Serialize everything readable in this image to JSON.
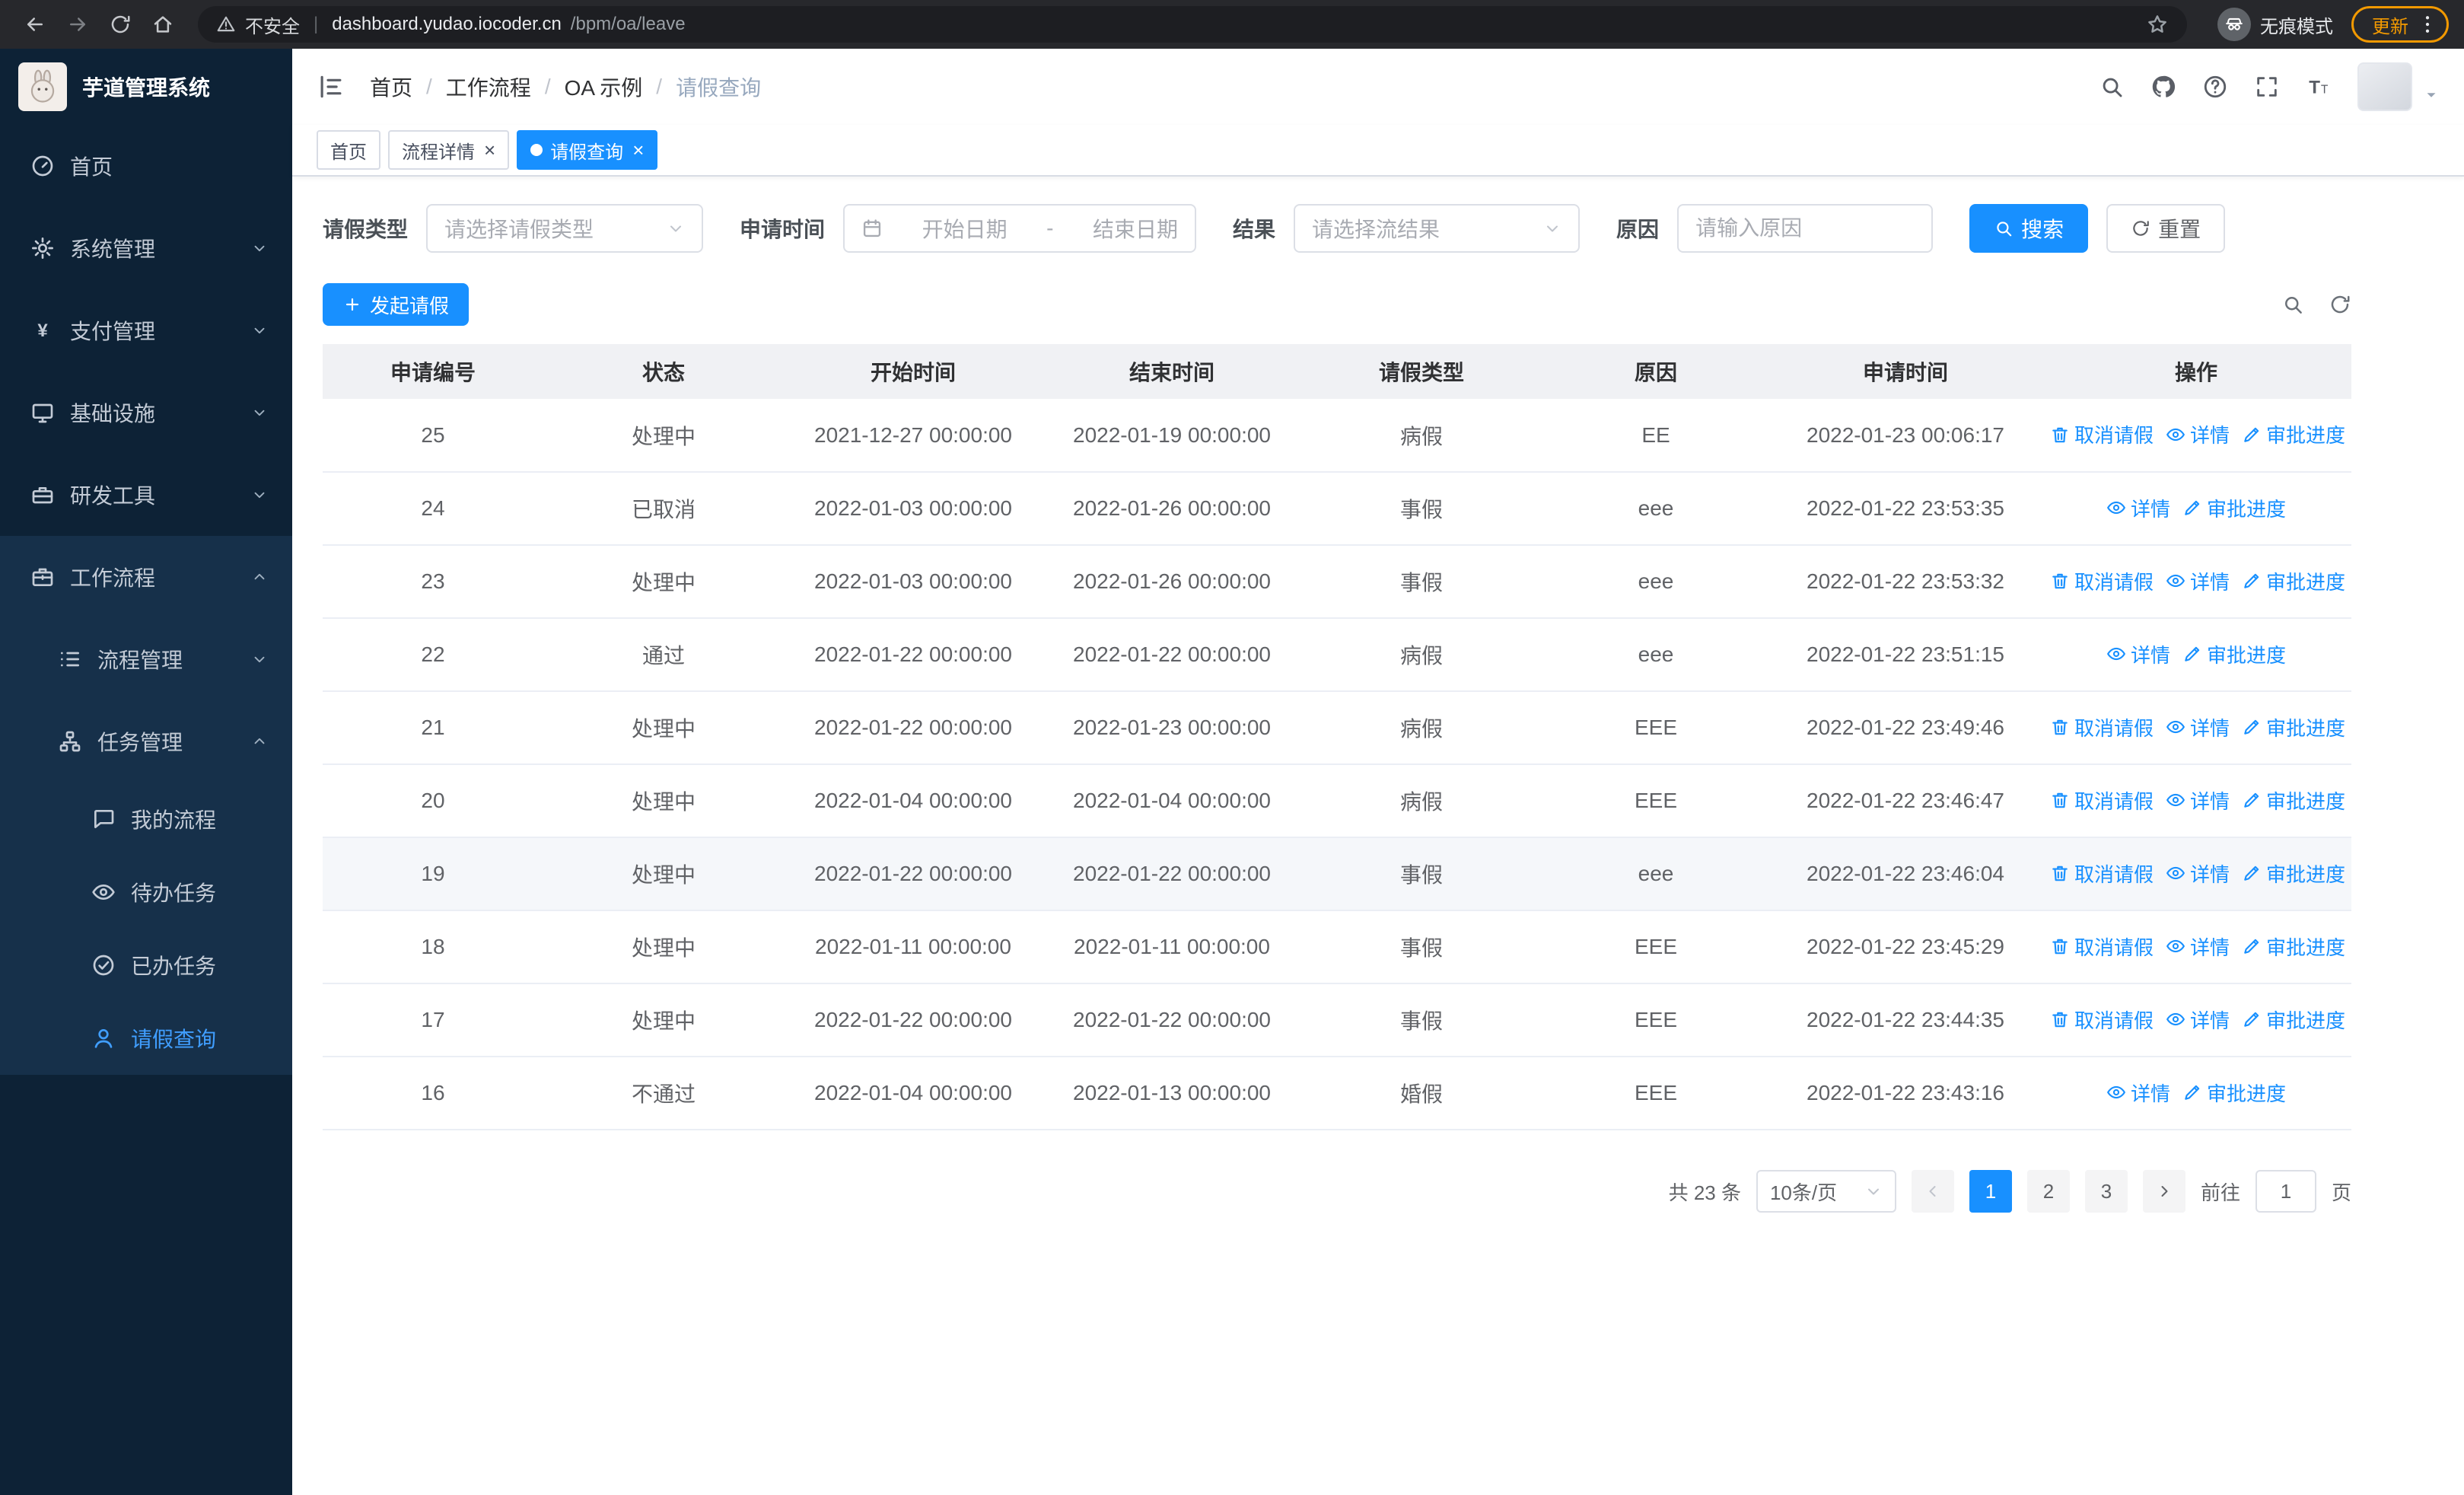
{
  "browser": {
    "security_label": "不安全",
    "separator": "|",
    "url_host": "dashboard.yudao.iocoder.cn",
    "url_path": "/bpm/oa/leave",
    "incognito_label": "无痕模式",
    "update_label": "更新"
  },
  "sidebar": {
    "logo_title": "芋道管理系统",
    "items": [
      {
        "key": "home",
        "label": "首页",
        "icon": "dashboard",
        "level": 1
      },
      {
        "key": "system",
        "label": "系统管理",
        "icon": "gear",
        "level": 1,
        "arrow": "down"
      },
      {
        "key": "payment",
        "label": "支付管理",
        "icon": "yen",
        "level": 1,
        "arrow": "down"
      },
      {
        "key": "infra",
        "label": "基础设施",
        "icon": "monitor",
        "level": 1,
        "arrow": "down"
      },
      {
        "key": "devtools",
        "label": "研发工具",
        "icon": "toolbox",
        "level": 1,
        "arrow": "down"
      },
      {
        "key": "workflow",
        "label": "工作流程",
        "icon": "briefcase",
        "level": 1,
        "arrow": "up",
        "section": true
      },
      {
        "key": "process-mgmt",
        "label": "流程管理",
        "icon": "list",
        "level": 2,
        "arrow": "down",
        "section": true
      },
      {
        "key": "task-mgmt",
        "label": "任务管理",
        "icon": "sitemap",
        "level": 2,
        "arrow": "up",
        "section": true
      },
      {
        "key": "my-process",
        "label": "我的流程",
        "icon": "chat",
        "level": 3,
        "section": true
      },
      {
        "key": "todo-task",
        "label": "待办任务",
        "icon": "eye",
        "level": 3,
        "section": true
      },
      {
        "key": "done-task",
        "label": "已办任务",
        "icon": "check-circle",
        "level": 3,
        "section": true
      },
      {
        "key": "leave-query",
        "label": "请假查询",
        "icon": "user",
        "level": 3,
        "active": true,
        "section": true
      }
    ]
  },
  "header": {
    "breadcrumb": [
      "首页",
      "工作流程",
      "OA 示例",
      "请假查询"
    ]
  },
  "tabs": [
    {
      "label": "首页",
      "active": false,
      "closable": false
    },
    {
      "label": "流程详情",
      "active": false,
      "closable": true
    },
    {
      "label": "请假查询",
      "active": true,
      "closable": true
    }
  ],
  "filters": {
    "type_label": "请假类型",
    "type_placeholder": "请选择请假类型",
    "time_label": "申请时间",
    "start_placeholder": "开始日期",
    "range_separator": "-",
    "end_placeholder": "结束日期",
    "result_label": "结果",
    "result_placeholder": "请选择流结果",
    "reason_label": "原因",
    "reason_placeholder": "请输入原因",
    "search_label": "搜索",
    "reset_label": "重置"
  },
  "toolbar": {
    "create_label": "发起请假"
  },
  "table": {
    "headers": [
      "申请编号",
      "状态",
      "开始时间",
      "结束时间",
      "请假类型",
      "原因",
      "申请时间",
      "操作"
    ],
    "action_labels": {
      "cancel": "取消请假",
      "detail": "详情",
      "progress": "审批进度"
    },
    "rows": [
      {
        "id": "25",
        "status": "处理中",
        "start": "2021-12-27 00:00:00",
        "end": "2022-01-19 00:00:00",
        "type": "病假",
        "reason": "EE",
        "applied": "2022-01-23 00:06:17",
        "actions": [
          "cancel",
          "detail",
          "progress"
        ]
      },
      {
        "id": "24",
        "status": "已取消",
        "start": "2022-01-03 00:00:00",
        "end": "2022-01-26 00:00:00",
        "type": "事假",
        "reason": "eee",
        "applied": "2022-01-22 23:53:35",
        "actions": [
          "detail",
          "progress"
        ]
      },
      {
        "id": "23",
        "status": "处理中",
        "start": "2022-01-03 00:00:00",
        "end": "2022-01-26 00:00:00",
        "type": "事假",
        "reason": "eee",
        "applied": "2022-01-22 23:53:32",
        "actions": [
          "cancel",
          "detail",
          "progress"
        ]
      },
      {
        "id": "22",
        "status": "通过",
        "start": "2022-01-22 00:00:00",
        "end": "2022-01-22 00:00:00",
        "type": "病假",
        "reason": "eee",
        "applied": "2022-01-22 23:51:15",
        "actions": [
          "detail",
          "progress"
        ]
      },
      {
        "id": "21",
        "status": "处理中",
        "start": "2022-01-22 00:00:00",
        "end": "2022-01-23 00:00:00",
        "type": "病假",
        "reason": "EEE",
        "applied": "2022-01-22 23:49:46",
        "actions": [
          "cancel",
          "detail",
          "progress"
        ]
      },
      {
        "id": "20",
        "status": "处理中",
        "start": "2022-01-04 00:00:00",
        "end": "2022-01-04 00:00:00",
        "type": "病假",
        "reason": "EEE",
        "applied": "2022-01-22 23:46:47",
        "actions": [
          "cancel",
          "detail",
          "progress"
        ]
      },
      {
        "id": "19",
        "status": "处理中",
        "start": "2022-01-22 00:00:00",
        "end": "2022-01-22 00:00:00",
        "type": "事假",
        "reason": "eee",
        "applied": "2022-01-22 23:46:04",
        "actions": [
          "cancel",
          "detail",
          "progress"
        ],
        "hover": true
      },
      {
        "id": "18",
        "status": "处理中",
        "start": "2022-01-11 00:00:00",
        "end": "2022-01-11 00:00:00",
        "type": "事假",
        "reason": "EEE",
        "applied": "2022-01-22 23:45:29",
        "actions": [
          "cancel",
          "detail",
          "progress"
        ]
      },
      {
        "id": "17",
        "status": "处理中",
        "start": "2022-01-22 00:00:00",
        "end": "2022-01-22 00:00:00",
        "type": "事假",
        "reason": "EEE",
        "applied": "2022-01-22 23:44:35",
        "actions": [
          "cancel",
          "detail",
          "progress"
        ]
      },
      {
        "id": "16",
        "status": "不通过",
        "start": "2022-01-04 00:00:00",
        "end": "2022-01-13 00:00:00",
        "type": "婚假",
        "reason": "EEE",
        "applied": "2022-01-22 23:43:16",
        "actions": [
          "detail",
          "progress"
        ]
      }
    ]
  },
  "pagination": {
    "total_label": "共 23 条",
    "page_size_label": "10条/页",
    "pages": [
      "1",
      "2",
      "3"
    ],
    "active_page": "1",
    "goto_label": "前往",
    "goto_value": "1",
    "page_unit": "页"
  },
  "colors": {
    "primary": "#1890ff",
    "sidebar_bg": "#0d2236",
    "sidebar_section_bg": "#16304a",
    "sidebar_active": "#409eff",
    "table_header_bg": "#f0f1f4",
    "update_orange": "#f29900"
  }
}
